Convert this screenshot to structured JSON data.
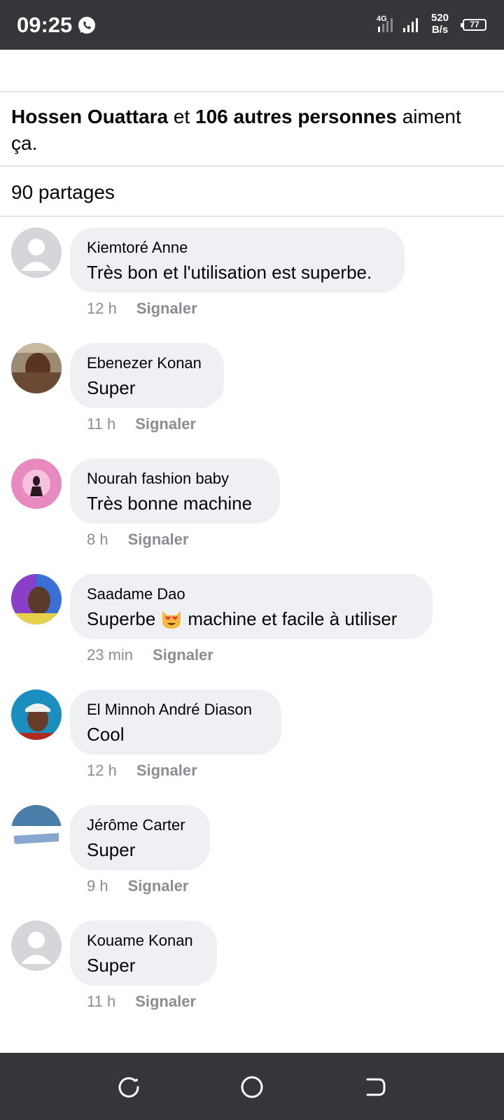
{
  "status_bar": {
    "time": "09:25",
    "network": "4G",
    "speed_value": "520",
    "speed_unit": "B/s",
    "battery": "77"
  },
  "likes": {
    "first_name": "Hossen Ouattara",
    "connector": " et ",
    "others": "106 autres personnes",
    "suffix": " aiment ça."
  },
  "shares": "90 partages",
  "report_label": "Signaler",
  "comments": [
    {
      "author": "Kiemtoré Anne",
      "text": "Très bon et l'utilisation est superbe.",
      "time": "12 h",
      "avatar": "default-avatar"
    },
    {
      "author": "Ebenezer Konan",
      "text": "Super",
      "time": "11 h",
      "avatar": "photo-avatar"
    },
    {
      "author": "Nourah fashion baby",
      "text": "Très bonne machine",
      "time": "8 h",
      "avatar": "photo-avatar"
    },
    {
      "author": "Saadame Dao",
      "text_before": "Superbe",
      "emoji": "heart-eyes-cat-emoji",
      "text_after": "machine et facile à utiliser",
      "time": "23 min",
      "avatar": "photo-avatar"
    },
    {
      "author": "El Minnoh André Diason",
      "text": "Cool",
      "time": "12 h",
      "avatar": "photo-avatar"
    },
    {
      "author": "Jérôme Carter",
      "text": "Super",
      "time": "9 h",
      "avatar": "photo-avatar"
    },
    {
      "author": "Kouame Konan",
      "text": "Super",
      "time": "11 h",
      "avatar": "default-avatar"
    }
  ],
  "colors": {
    "status_bar_bg": "#35363a",
    "bubble_bg": "#eff0f3",
    "meta_text": "#8a8d91",
    "divider": "#e4e6eb"
  }
}
